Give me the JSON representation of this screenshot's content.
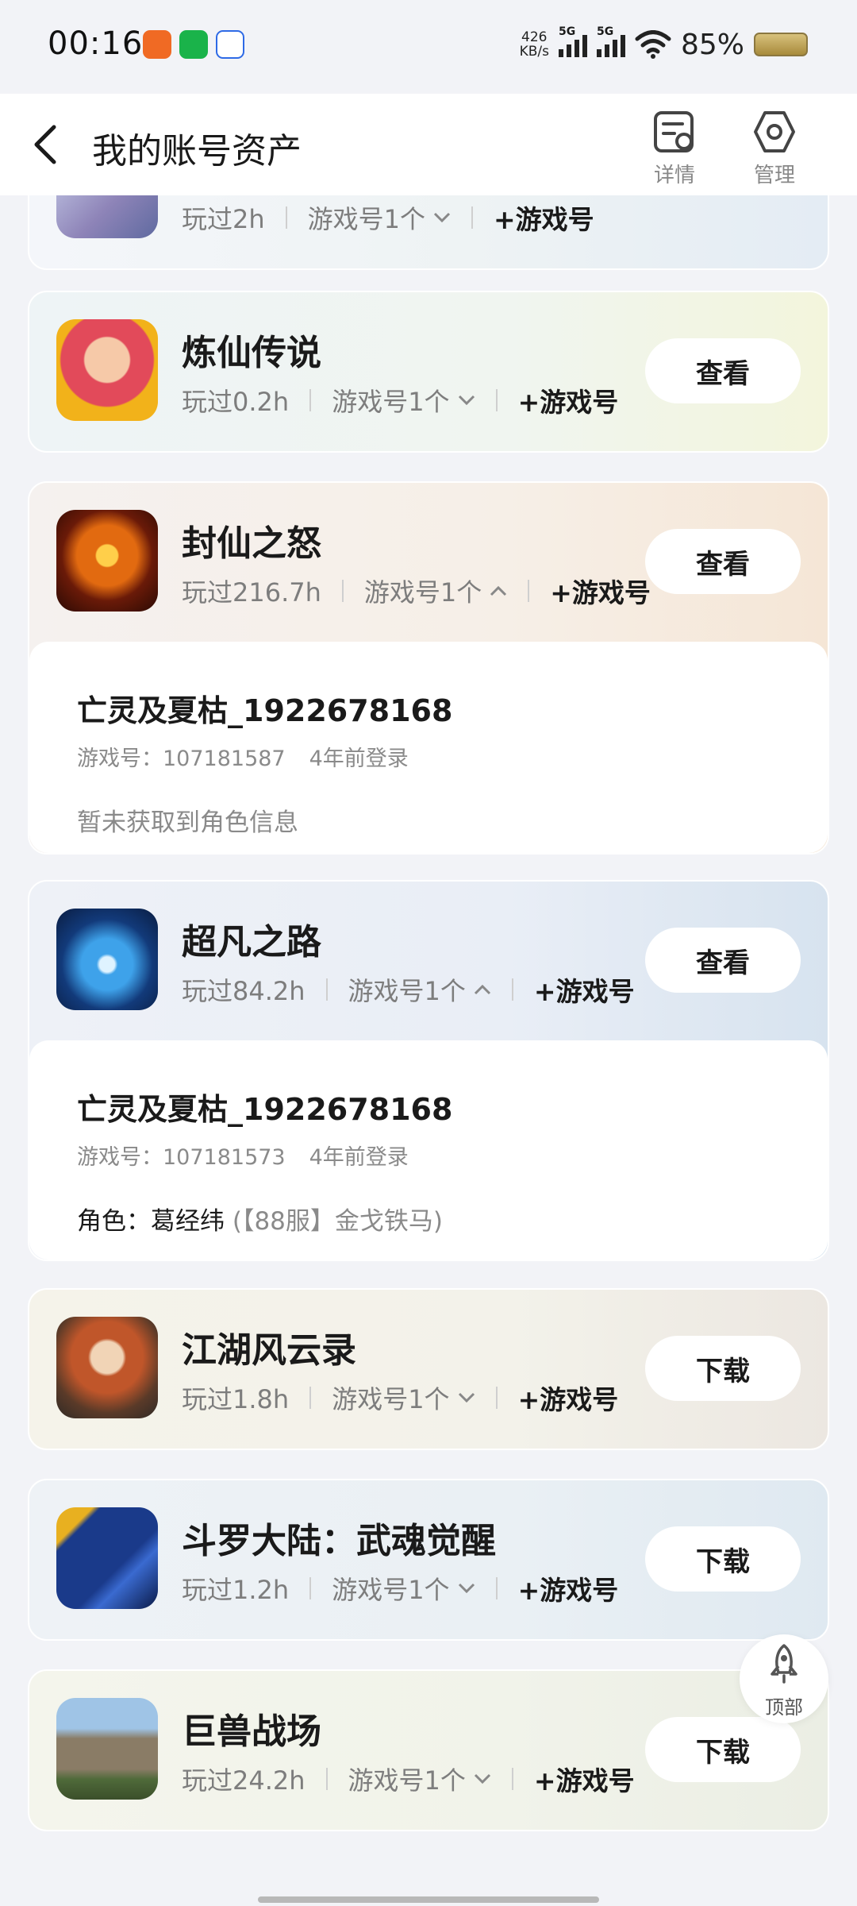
{
  "status_bar": {
    "time": "00:16",
    "speed_value": "426",
    "speed_unit": "KB/s",
    "signal_1": "5G",
    "signal_2": "5G",
    "battery": "85%"
  },
  "header": {
    "title": "我的账号资产",
    "detail_label": "详情",
    "manage_label": "管理"
  },
  "games": [
    {
      "name": "",
      "played": "玩过2h",
      "accounts": "游戏号1个",
      "add": "+游戏号",
      "action": ""
    },
    {
      "name": "炼仙传说",
      "played": "玩过0.2h",
      "accounts": "游戏号1个",
      "add": "+游戏号",
      "action": "查看"
    },
    {
      "name": "封仙之怒",
      "played": "玩过216.7h",
      "accounts": "游戏号1个",
      "add": "+游戏号",
      "action": "查看",
      "account": {
        "name": "亡灵及夏枯_1922678168",
        "id": "游戏号：107181587",
        "login": "4年前登录",
        "role": "暂未获取到角色信息"
      }
    },
    {
      "name": "超凡之路",
      "played": "玩过84.2h",
      "accounts": "游戏号1个",
      "add": "+游戏号",
      "action": "查看",
      "account": {
        "name": "亡灵及夏枯_1922678168",
        "id": "游戏号：107181573",
        "login": "4年前登录",
        "role_label": "角色：葛经纬",
        "role_server": "(【88服】金戈铁马)"
      }
    },
    {
      "name": "江湖风云录",
      "played": "玩过1.8h",
      "accounts": "游戏号1个",
      "add": "+游戏号",
      "action": "下载"
    },
    {
      "name": "斗罗大陆：武魂觉醒",
      "played": "玩过1.2h",
      "accounts": "游戏号1个",
      "add": "+游戏号",
      "action": "下载"
    },
    {
      "name": "巨兽战场",
      "played": "玩过24.2h",
      "accounts": "游戏号1个",
      "add": "+游戏号",
      "action": "下载"
    }
  ],
  "fab": {
    "label": "顶部"
  },
  "icons": [
    "back-icon",
    "detail-icon",
    "manage-icon",
    "chevron-down-icon",
    "chevron-up-icon",
    "rocket-icon"
  ]
}
